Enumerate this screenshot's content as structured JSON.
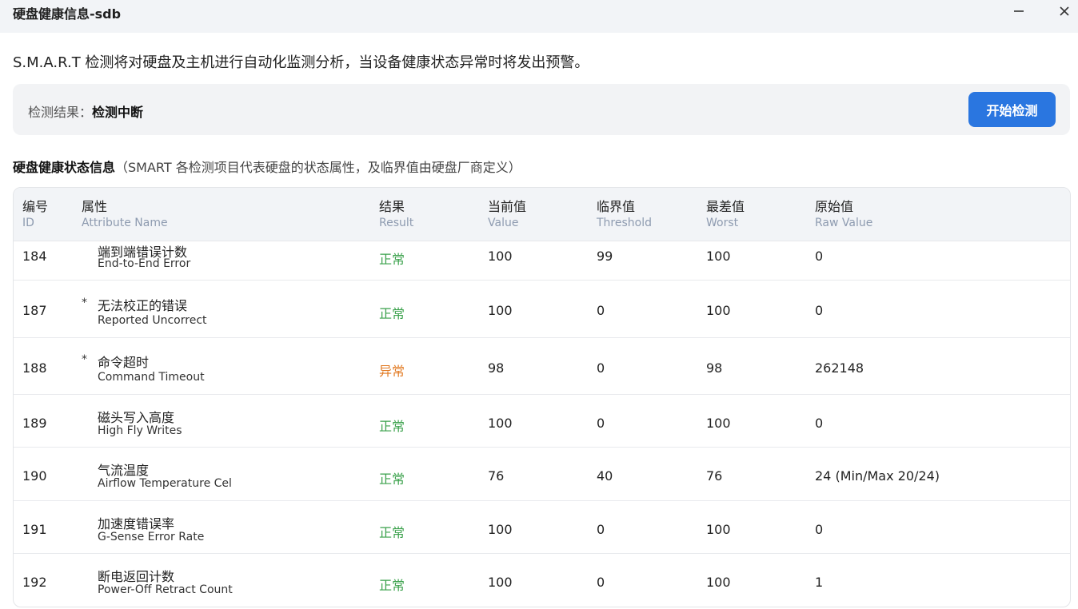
{
  "window": {
    "title": "硬盘健康信息-sdb",
    "minimize_icon": "minimize-icon",
    "close_icon": "close-icon"
  },
  "description": "S.M.A.R.T 检测将对硬盘及主机进行自动化监测分析，当设备健康状态异常时将发出预警。",
  "result": {
    "label": "检测结果：",
    "value": "检测中断",
    "button_label": "开始检测",
    "button_color": "#2a76e0"
  },
  "section": {
    "title": "硬盘健康状态信息",
    "note": "（SMART 各检测项目代表硬盘的状态属性，及临界值由硬盘厂商定义）"
  },
  "colors": {
    "normal": "#3aa14b",
    "abnormal": "#e27a22"
  },
  "table": {
    "headers": [
      {
        "cn": "编号",
        "en": "ID"
      },
      {
        "cn": "属性",
        "en": "Attribute Name"
      },
      {
        "cn": "结果",
        "en": "Result"
      },
      {
        "cn": "当前值",
        "en": "Value"
      },
      {
        "cn": "临界值",
        "en": "Threshold"
      },
      {
        "cn": "最差值",
        "en": "Worst"
      },
      {
        "cn": "原始值",
        "en": "Raw Value"
      }
    ],
    "rows": [
      {
        "id": "184",
        "star": "",
        "attr_cn": "端到端错误计数",
        "attr_en": "End-to-End Error",
        "result": "正常",
        "status": "ok",
        "value": "100",
        "threshold": "99",
        "worst": "100",
        "raw": "0"
      },
      {
        "id": "187",
        "star": "*",
        "attr_cn": "无法校正的错误",
        "attr_en": "Reported Uncorrect",
        "result": "正常",
        "status": "ok",
        "value": "100",
        "threshold": "0",
        "worst": "100",
        "raw": "0"
      },
      {
        "id": "188",
        "star": "*",
        "attr_cn": "命令超时",
        "attr_en": "Command Timeout",
        "result": "异常",
        "status": "bad",
        "value": "98",
        "threshold": "0",
        "worst": "98",
        "raw": "262148"
      },
      {
        "id": "189",
        "star": "",
        "attr_cn": "磁头写入高度",
        "attr_en": "High Fly Writes",
        "result": "正常",
        "status": "ok",
        "value": "100",
        "threshold": "0",
        "worst": "100",
        "raw": "0"
      },
      {
        "id": "190",
        "star": "",
        "attr_cn": "气流温度",
        "attr_en": "Airflow Temperature Cel",
        "result": "正常",
        "status": "ok",
        "value": "76",
        "threshold": "40",
        "worst": "76",
        "raw": "24 (Min/Max 20/24)"
      },
      {
        "id": "191",
        "star": "",
        "attr_cn": "加速度错误率",
        "attr_en": "G-Sense Error Rate",
        "result": "正常",
        "status": "ok",
        "value": "100",
        "threshold": "0",
        "worst": "100",
        "raw": "0"
      },
      {
        "id": "192",
        "star": "",
        "attr_cn": "断电返回计数",
        "attr_en": "Power-Off Retract Count",
        "result": "正常",
        "status": "ok",
        "value": "100",
        "threshold": "0",
        "worst": "100",
        "raw": "1"
      }
    ]
  }
}
